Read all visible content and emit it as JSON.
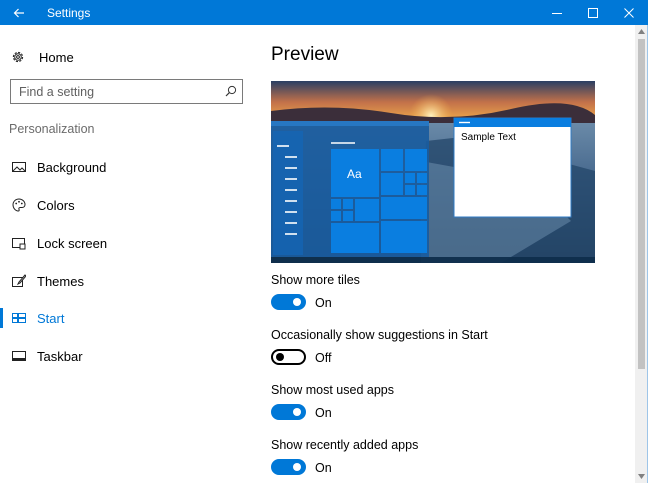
{
  "window": {
    "title": "Settings"
  },
  "sidebar": {
    "home_label": "Home",
    "search_placeholder": "Find a setting",
    "section_label": "Personalization",
    "items": [
      {
        "label": "Background",
        "icon": "picture-icon"
      },
      {
        "label": "Colors",
        "icon": "palette-icon"
      },
      {
        "label": "Lock screen",
        "icon": "lock-screen-icon"
      },
      {
        "label": "Themes",
        "icon": "brush-icon"
      },
      {
        "label": "Start",
        "icon": "start-tiles-icon",
        "active": true
      },
      {
        "label": "Taskbar",
        "icon": "taskbar-icon"
      }
    ]
  },
  "main": {
    "title": "Preview",
    "preview": {
      "tile_text": "Aa",
      "window_text": "Sample Text"
    },
    "settings": [
      {
        "label": "Show more tiles",
        "state": "On"
      },
      {
        "label": "Occasionally show suggestions in Start",
        "state": "Off"
      },
      {
        "label": "Show most used apps",
        "state": "On"
      },
      {
        "label": "Show recently added apps",
        "state": "On"
      }
    ]
  },
  "colors": {
    "accent": "#0078d7"
  }
}
